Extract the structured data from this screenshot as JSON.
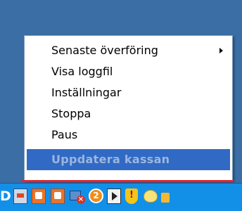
{
  "context_menu": {
    "items": [
      {
        "label": "Senaste överföring",
        "has_submenu": true
      },
      {
        "label": "Visa loggfil",
        "has_submenu": false
      },
      {
        "label": "Inställningar",
        "has_submenu": false
      },
      {
        "label": "Stoppa",
        "has_submenu": false
      },
      {
        "label": "Paus",
        "has_submenu": false
      },
      {
        "label": "Uppdatera kassan",
        "has_submenu": false,
        "state": "highlighted-disabled"
      }
    ]
  },
  "tray": {
    "leading_label": "D",
    "icons": [
      {
        "name": "network-card-icon"
      },
      {
        "name": "orange-app-icon"
      },
      {
        "name": "orange-app-icon"
      },
      {
        "name": "network-error-icon"
      },
      {
        "name": "update-badge-icon",
        "badge": "2"
      },
      {
        "name": "media-player-icon"
      },
      {
        "name": "shield-warning-icon",
        "glyph": "!"
      },
      {
        "name": "messenger-icon"
      },
      {
        "name": "partial-tray-icon"
      }
    ]
  },
  "colors": {
    "desktop": "#3a6ea5",
    "menu_highlight": "#316ac5",
    "highlight_text": "#9cb6dc",
    "underline": "#e0262f",
    "taskbar": "#1290e8"
  }
}
